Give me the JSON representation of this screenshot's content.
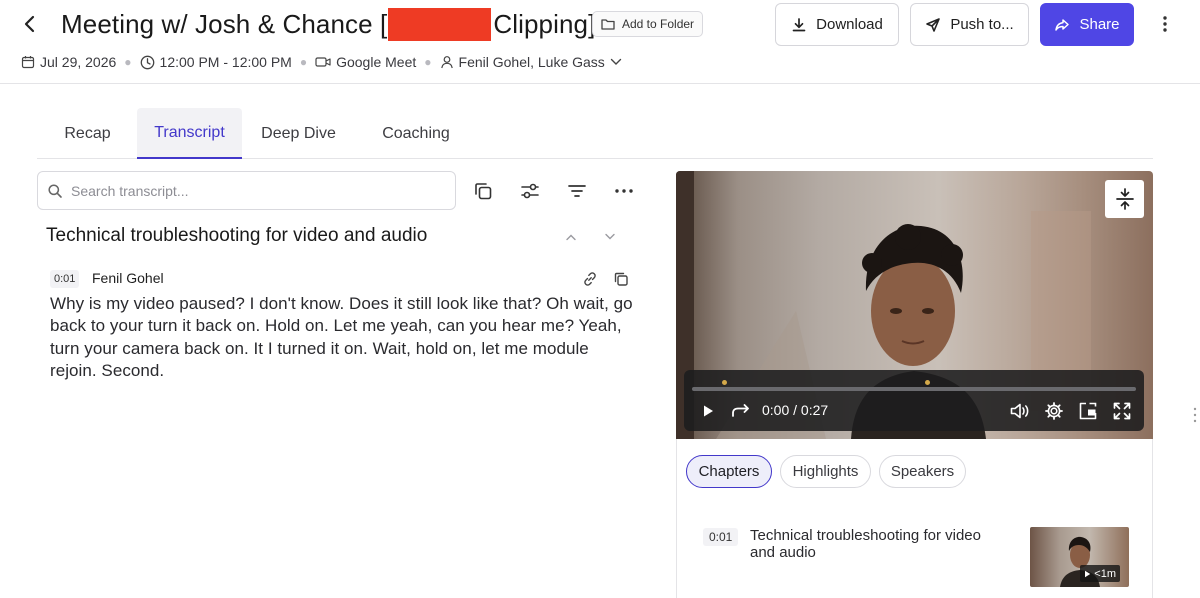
{
  "header": {
    "title_prefix": "Meeting w/ Josh & Chance [",
    "title_suffix": "Clipping]",
    "add_to_folder": "Add to Folder",
    "download": "Download",
    "push_to": "Push to...",
    "share": "Share",
    "accent_color": "#4f46e5",
    "redaction_color": "#ee3b24"
  },
  "meta": {
    "date": "Jul 29, 2026",
    "time": "12:00 PM - 12:00 PM",
    "platform": "Google Meet",
    "participants": "Fenil Gohel, Luke Gass"
  },
  "tabs": [
    {
      "label": "Recap",
      "active": false
    },
    {
      "label": "Transcript",
      "active": true
    },
    {
      "label": "Deep Dive",
      "active": false
    },
    {
      "label": "Coaching",
      "active": false
    }
  ],
  "search": {
    "placeholder": "Search transcript...",
    "value": ""
  },
  "transcript": {
    "chapter_title": "Technical troubleshooting for video and audio",
    "segments": [
      {
        "timestamp": "0:01",
        "speaker": "Fenil Gohel",
        "text": "Why is my video paused? I don't know. Does it still look like that? Oh wait, go back to your turn it back on. Hold on. Let me yeah, can you hear me? Yeah, turn your camera back on. It I turned it on. Wait, hold on, let me module rejoin. Second."
      }
    ]
  },
  "player": {
    "current_time": "0:00",
    "separator": "/",
    "duration": "0:27",
    "progress": 0.0
  },
  "side_panel": {
    "tabs": [
      {
        "label": "Chapters",
        "active": true
      },
      {
        "label": "Highlights",
        "active": false
      },
      {
        "label": "Speakers",
        "active": false
      }
    ],
    "chapters": [
      {
        "timestamp": "0:01",
        "title": "Technical troubleshooting for video and audio",
        "duration_badge": "<1m"
      }
    ]
  }
}
